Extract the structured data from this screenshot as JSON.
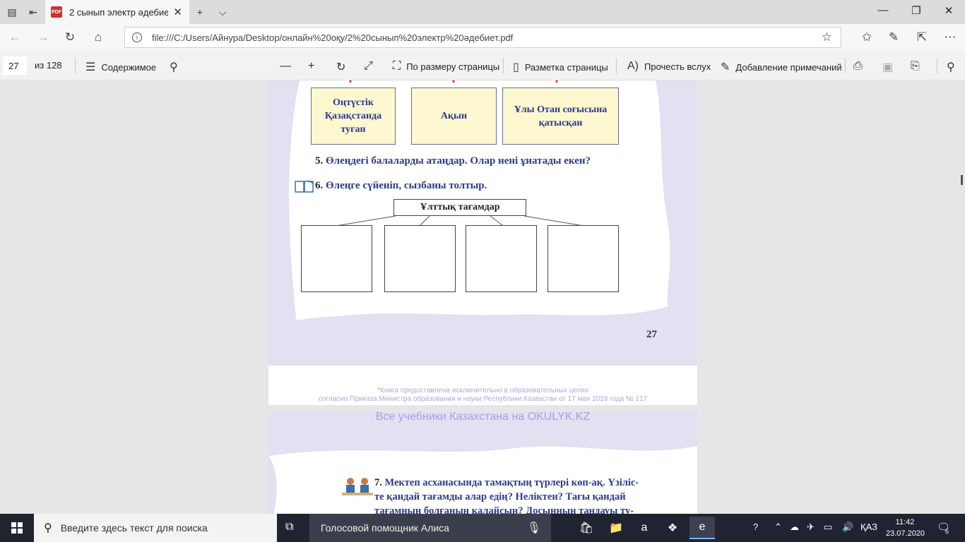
{
  "browser": {
    "tab_title": "2 сынып электр әдебиет",
    "url": "file:///C:/Users/Айнура/Desktop/онлайн%20оқу/2%20сынып%20электр%20әдебиет.pdf"
  },
  "pdf_toolbar": {
    "page_current": "27",
    "page_total": "из 128",
    "contents": "Содержимое",
    "fit_page": "По размеру страницы",
    "page_layout": "Разметка страницы",
    "read_aloud": "Прочесть вслух",
    "add_notes": "Добавление примечаний"
  },
  "page": {
    "box1": "Оңтүстік Қазақстанда туған",
    "box2": "Ақын",
    "box3": "Ұлы Отан соғысына қатысқан",
    "task5_num": "5.",
    "task5": "Өлеңдегі балаларды атаңдар. Олар нені ұнатады екен?",
    "task6_num": "6.",
    "task6": "Өлеңге сүйеніп, сызбаны толтыр.",
    "diagram_title": "Ұлттық тағамдар",
    "page_number": "27",
    "notice_line1": "*Книга предоставлена исключительно в образовательных целях",
    "notice_line2": "согласно Приказа Министра образования и науки Республики Казахстан от 17 мая 2019 года № 217",
    "watermark": "Все учебники Казахстана на OKULYK.KZ",
    "task7_num": "7.",
    "task7_line1": "Мектеп асханасында тамақтың түрлері көп-ақ. Үзіліс-",
    "task7_line2": "те қандай тағамды алар едің? Неліктен? Тағы қандай",
    "task7_line3": "тағамның болғанын қалайсың? Досыңның таңдауы ту-"
  },
  "taskbar": {
    "search_placeholder": "Введите здесь текст для поиска",
    "assistant": "Голосовой помощник Алиса",
    "lang": "ҚАЗ",
    "time": "11:42",
    "date": "23.07.2020",
    "notif_count": "5"
  },
  "colors": {
    "accent_lilac": "#e3e0f2",
    "box_fill": "#fdf8d0",
    "text_blue": "#2b3a8a"
  }
}
